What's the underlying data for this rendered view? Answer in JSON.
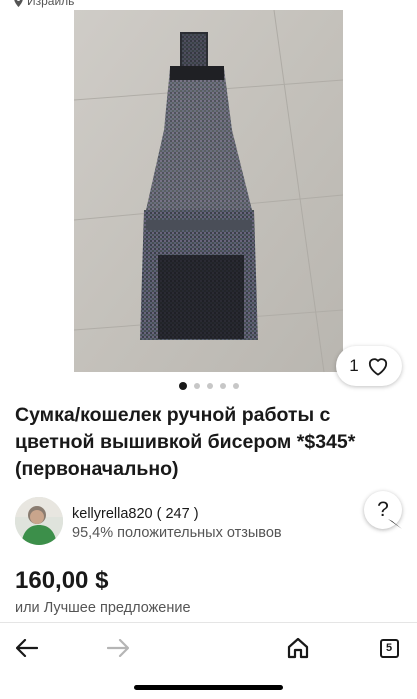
{
  "header": {
    "location_text": "Израиль",
    "location_icon": "location-pin-icon"
  },
  "gallery": {
    "image_description_icon": "product-photo-beaded-bag",
    "like_count": "1",
    "like_icon": "heart-outline-icon",
    "pager": {
      "total": 5,
      "active_index": 0
    }
  },
  "listing": {
    "title": "Сумка/кошелек ручной работы с цветной вышивкой бисером *$345* (первоначально)",
    "price": "160,00 $",
    "offer_text": "или Лучшее предложение"
  },
  "seller": {
    "name": "kellyrella820 ( 247 )",
    "feedback": "95,4% положительных отзывов",
    "help_label": "?"
  },
  "navbar": {
    "back_icon": "arrow-left-icon",
    "forward_icon": "arrow-right-icon",
    "home_icon": "home-icon",
    "tabs_icon": "tabs-icon",
    "tabs_count": "5"
  },
  "colors": {
    "text_primary": "#191919",
    "text_secondary": "#555555",
    "dot_inactive": "#c7c7c7",
    "gallery_bg": "#f5f5f5"
  }
}
